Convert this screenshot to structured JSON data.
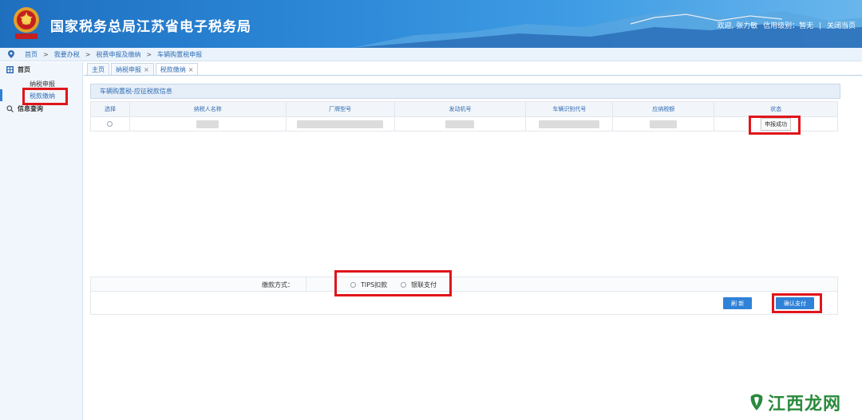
{
  "header": {
    "title": "国家税务总局江苏省电子税务局",
    "welcome": "欢迎, 张力敏",
    "credit": "信用级别：暂无",
    "divider": "|",
    "close": "关闭当页"
  },
  "breadcrumb": [
    "首页",
    "我要办税",
    "税费申报及缴纳",
    "车辆购置税申报"
  ],
  "breadcrumb_sep": ">",
  "sidebar": {
    "home": "首页",
    "items": [
      "纳税申报",
      "税款缴纳"
    ],
    "info": "信息查询"
  },
  "tabs": [
    {
      "label": "主页",
      "close": ""
    },
    {
      "label": "纳税申报",
      "close": "×"
    },
    {
      "label": "税款缴纳",
      "close": "×"
    }
  ],
  "panel": {
    "title": "车辆购置税-应征税款信息",
    "columns": [
      "选择",
      "纳税人名称",
      "厂牌型号",
      "发动机号",
      "车辆识别代号",
      "应纳税额",
      "状态"
    ],
    "row": {
      "status": "申报成功"
    }
  },
  "payment": {
    "label": "缴款方式：",
    "options": [
      "TIPS扣款",
      "银联支付"
    ]
  },
  "actions": {
    "refresh": "刷 新",
    "confirm": "确认支付"
  },
  "watermark": "江西龙网",
  "colors": {
    "brand": "#2b86d6",
    "highlight": "#e0151b",
    "button": "#2f82d8"
  }
}
